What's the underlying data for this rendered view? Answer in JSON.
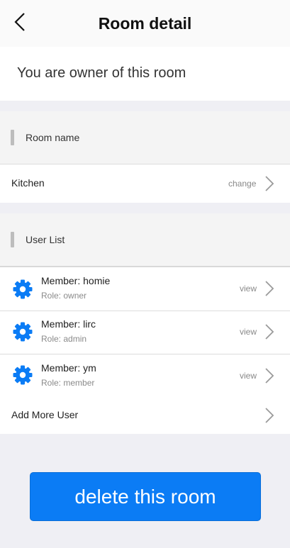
{
  "header": {
    "title": "Room detail"
  },
  "owner_banner": {
    "text": "You are owner of this room"
  },
  "room_name_section": {
    "title": "Room name",
    "room_name": "Kitchen",
    "action": "change"
  },
  "user_list_section": {
    "title": "User List",
    "members": [
      {
        "name": "Member: homie",
        "role": "Role: owner",
        "action": "view"
      },
      {
        "name": "Member: lirc",
        "role": "Role: admin",
        "action": "view"
      },
      {
        "name": "Member: ym",
        "role": "Role: member",
        "action": "view"
      }
    ],
    "add_more": "Add More User"
  },
  "delete_button": {
    "label": "delete this room"
  },
  "colors": {
    "accent": "#0b7cf5",
    "background": "#efeff4",
    "icon": "#0b7cf5"
  }
}
